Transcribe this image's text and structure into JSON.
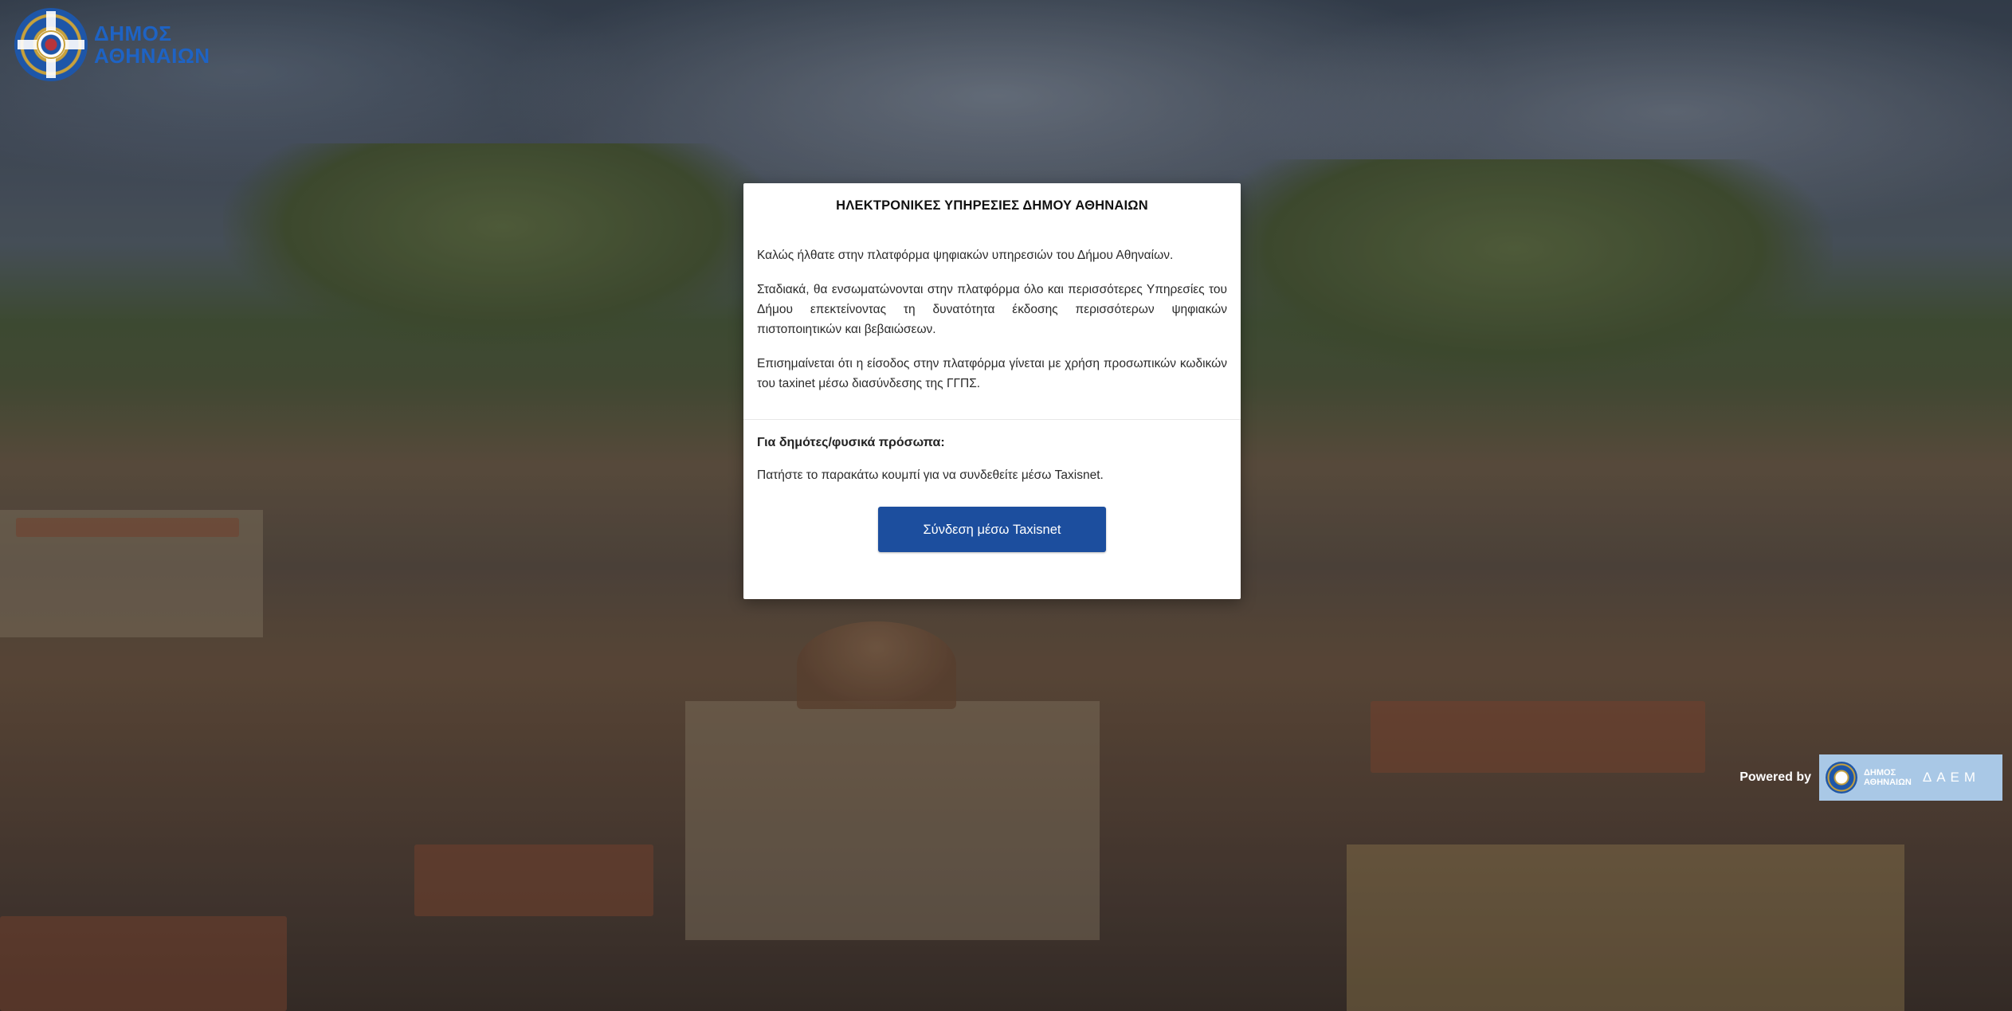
{
  "header": {
    "logo_line1": "ΔΗΜΟΣ",
    "logo_line2": "ΑΘΗΝΑΙΩΝ"
  },
  "modal": {
    "title": "ΗΛΕΚΤΡΟΝΙΚΕΣ ΥΠΗΡΕΣΙΕΣ ΔΗΜΟΥ ΑΘΗΝΑΙΩΝ",
    "paragraphs": [
      "Καλώς ήλθατε στην πλατφόρμα ψηφιακών υπηρεσιών του Δήμου Αθηναίων.",
      "Σταδιακά, θα ενσωματώνονται στην πλατφόρμα όλο και περισσότερες Υπηρεσίες του Δήμου επεκτείνοντας τη δυνατότητα έκδοσης περισσότερων ψηφιακών πιστοποιητικών και βεβαιώσεων.",
      "Επισημαίνεται ότι η είσοδος στην πλατφόρμα γίνεται με χρήση προσωπικών κωδικών του taxinet μέσω διασύνδεσης της ΓΓΠΣ."
    ],
    "section_heading": "Για δημότες/φυσικά πρόσωπα:",
    "section_text": "Πατήστε το παρακάτω κουμπί για να συνδεθείτε μέσω Taxisnet.",
    "login_button": "Σύνδεση μέσω Taxisnet"
  },
  "footer": {
    "powered_label": "Powered by",
    "badge_line1": "ΔΗΜΟΣ",
    "badge_line2": "ΑΘΗΝΑΙΩΝ",
    "badge_brand": "ΔΑΕΜ"
  },
  "colors": {
    "button": "#1c4e9e",
    "logo_text": "#1e63c4",
    "badge_bg": "#a9c8e6"
  }
}
